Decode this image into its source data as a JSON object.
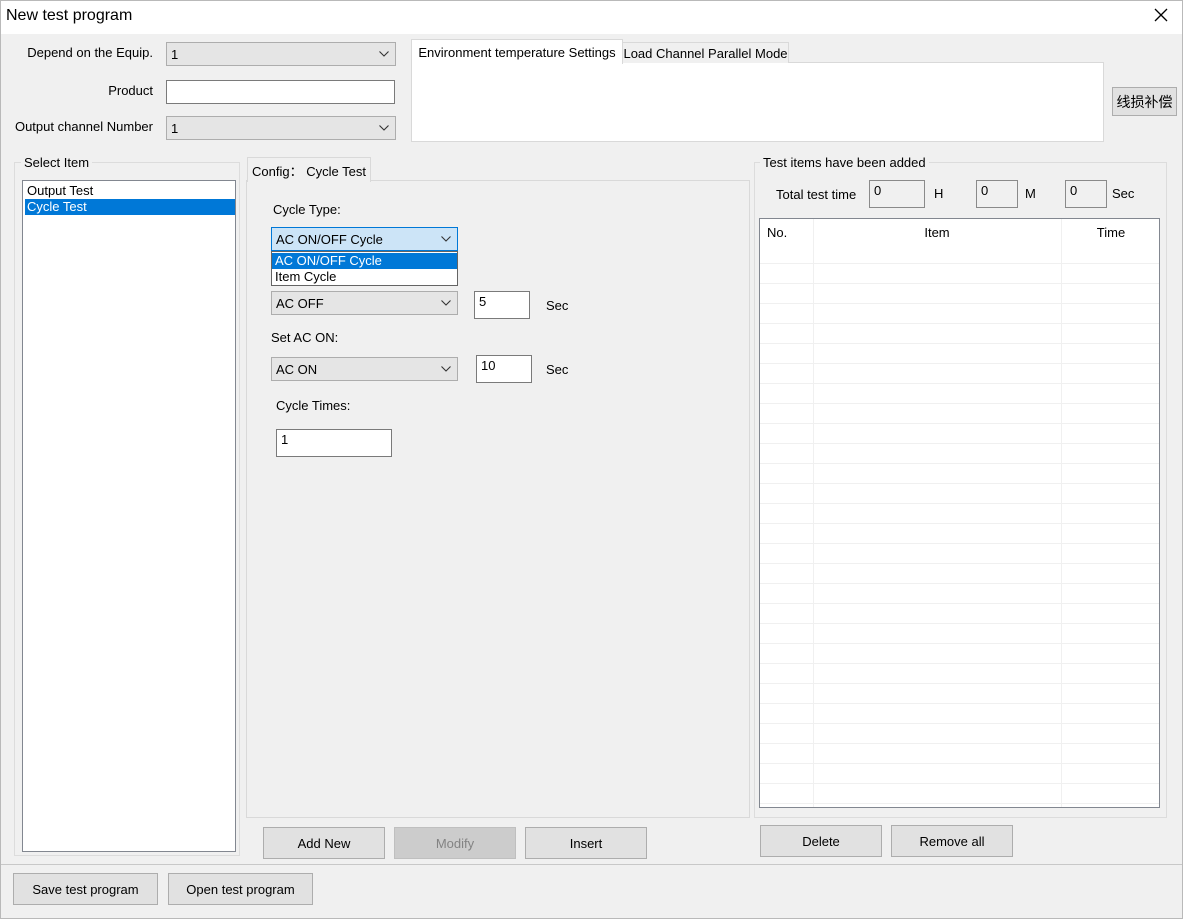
{
  "window": {
    "title": "New test program",
    "close_glyph": "✕"
  },
  "top_form": {
    "depend_label": "Depend on the Equip.",
    "depend_value": "1",
    "product_label": "Product",
    "product_value": "",
    "output_channel_label": "Output channel Number",
    "output_channel_value": "1"
  },
  "top_tabs": [
    {
      "label": "Environment temperature Settings",
      "active": true
    },
    {
      "label": "Load Channel Parallel Mode",
      "active": false
    }
  ],
  "line_loss_button": "线损补偿",
  "select_item": {
    "title": "Select Item",
    "items": [
      {
        "label": "Output Test",
        "selected": false
      },
      {
        "label": "Cycle Test",
        "selected": true
      }
    ]
  },
  "config": {
    "tab_label": "Config： Cycle Test",
    "cycle_type_label": "Cycle Type:",
    "cycle_type_value": "AC ON/OFF Cycle",
    "cycle_type_options": [
      {
        "label": "AC ON/OFF Cycle",
        "selected": true
      },
      {
        "label": "Item Cycle",
        "selected": false
      }
    ],
    "ac_off_value": "AC OFF",
    "ac_off_seconds": "5",
    "sec_unit": "Sec",
    "set_ac_on_label": "Set AC ON:",
    "ac_on_value": "AC ON",
    "ac_on_seconds": "10",
    "cycle_times_label": "Cycle Times:",
    "cycle_times_value": "1"
  },
  "action_buttons": {
    "add_new": "Add New",
    "modify": "Modify",
    "insert": "Insert"
  },
  "added_items": {
    "title": "Test items have been added",
    "total_time_label": "Total test time",
    "hours_value": "0",
    "hours_unit": "H",
    "minutes_value": "0",
    "minutes_unit": "M",
    "seconds_value": "0",
    "seconds_unit": "Sec",
    "columns": [
      "No.",
      "Item",
      "Time"
    ],
    "delete_button": "Delete",
    "remove_all_button": "Remove all"
  },
  "bottom_buttons": {
    "save": "Save test program",
    "open": "Open test program"
  },
  "icons": {
    "combo_arrow": "chevron-down-icon",
    "close": "close-icon"
  }
}
